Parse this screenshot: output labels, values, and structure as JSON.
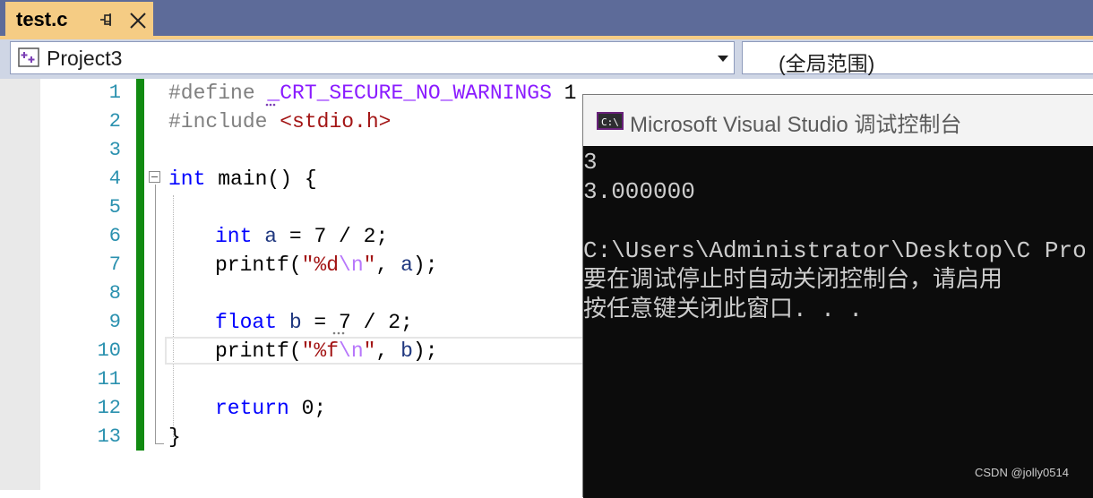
{
  "tab": {
    "title": "test.c"
  },
  "navbar": {
    "project": "Project3",
    "scope": "(全局范围)"
  },
  "editor": {
    "line_numbers": [
      "1",
      "2",
      "3",
      "4",
      "5",
      "6",
      "7",
      "8",
      "9",
      "10",
      "11",
      "12",
      "13"
    ],
    "lines": {
      "l1": {
        "pp": "#define ",
        "macro": "_CRT_SECURE_NO_WARNINGS",
        "val": " 1"
      },
      "l2": {
        "pp": "#include ",
        "hdr": "<stdio.h>"
      },
      "l4": {
        "kw": "int",
        "rest": " main() {"
      },
      "l6": {
        "kw": "int",
        "var": " a",
        "rest": " = 7 / 2;"
      },
      "l7": {
        "fn": "printf(",
        "s1": "\"%d",
        "esc": "\\n",
        "s2": "\"",
        "rest1": ", ",
        "var": "a",
        "rest2": ");"
      },
      "l9": {
        "kw": "float",
        "var": " b",
        "rest": " = 7 / 2;"
      },
      "l10": {
        "fn": "printf(",
        "s1": "\"%f",
        "esc": "\\n",
        "s2": "\"",
        "rest1": ", ",
        "var": "b",
        "rest2": ");"
      },
      "l12": {
        "kw": "return",
        "rest": " 0;"
      },
      "l13": {
        "rest": "}"
      }
    }
  },
  "console": {
    "title": "Microsoft Visual Studio 调试控制台",
    "output": [
      "3",
      "3.000000",
      "",
      "C:\\Users\\Administrator\\Desktop\\C Pro",
      "要在调试停止时自动关闭控制台，请启用",
      "按任意键关闭此窗口. . ."
    ]
  },
  "watermark": "CSDN @jolly0514",
  "colors": {
    "tab_bg": "#f5cc84",
    "strip_bg": "#5d6b99",
    "change_bar": "#118a11",
    "line_number": "#2b91af",
    "keyword": "#0000ff"
  }
}
